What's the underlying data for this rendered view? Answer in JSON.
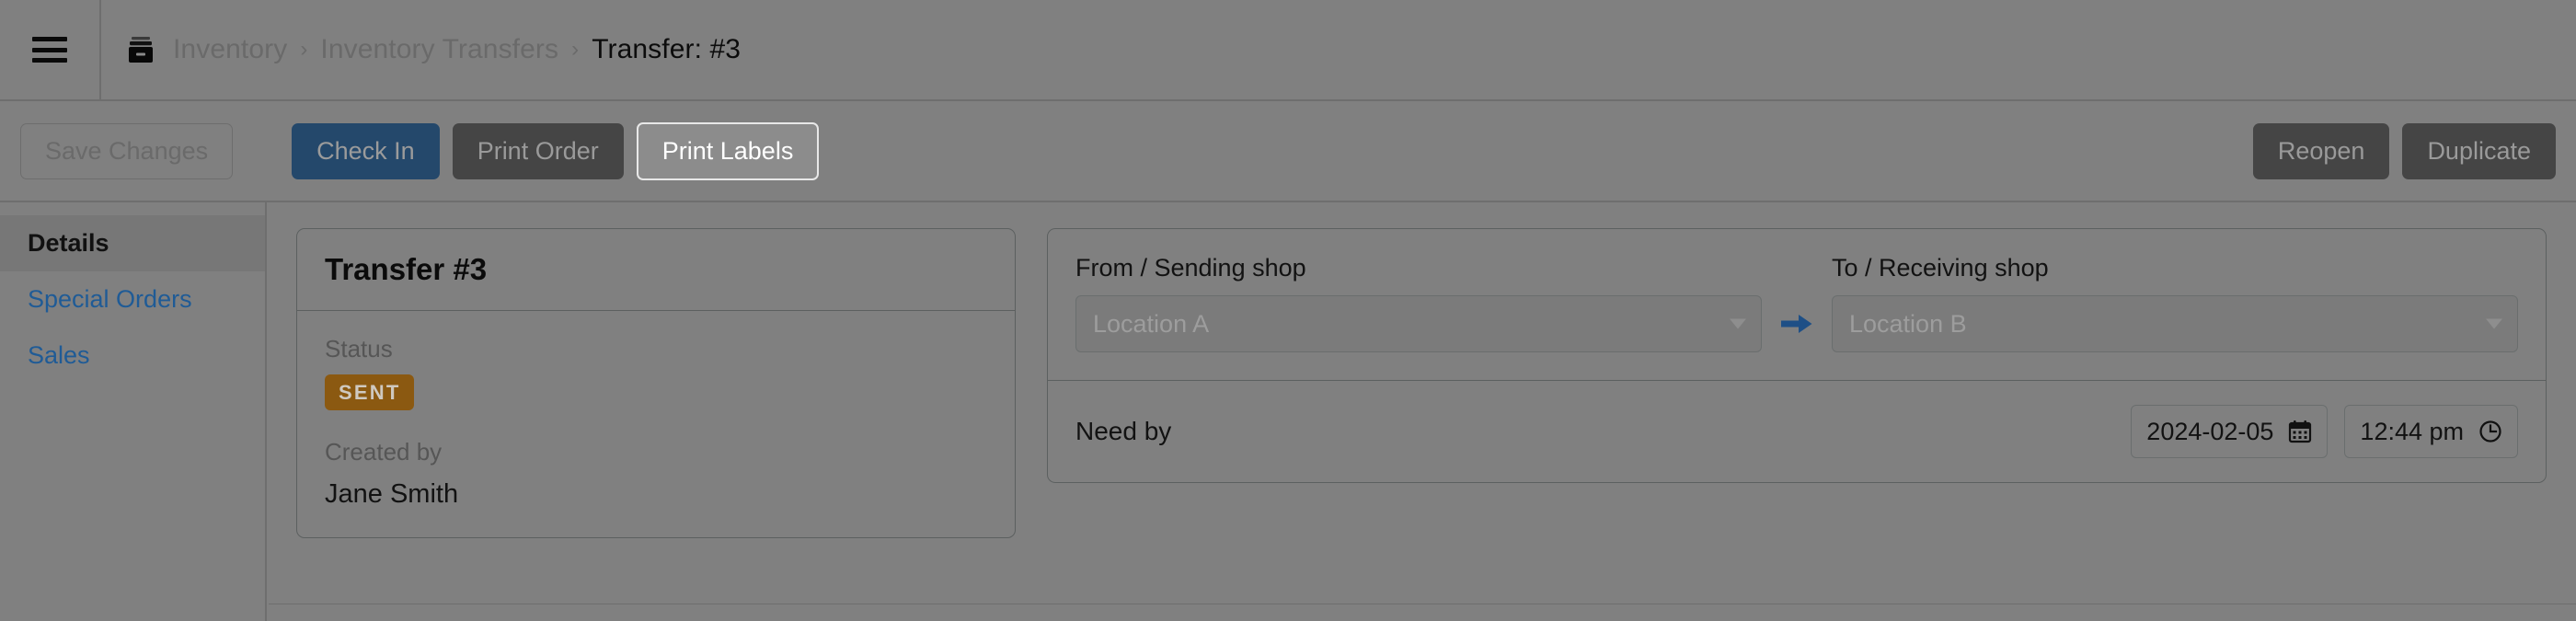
{
  "window": {
    "title": "Transfer: #3"
  },
  "topbar": {
    "menu_icon": "hamburger-icon",
    "breadcrumb": {
      "icon": "archive-box-icon",
      "items": [
        {
          "label": "Inventory",
          "current": false
        },
        {
          "label": "Inventory Transfers",
          "current": false
        },
        {
          "label": "Transfer: #3",
          "current": true
        }
      ],
      "separator": "›"
    }
  },
  "toolbar": {
    "left": [
      {
        "label": "Save Changes",
        "style": "ghost-disabled"
      },
      {
        "label": "Check In",
        "style": "primary"
      },
      {
        "label": "Print Order",
        "style": "dark"
      },
      {
        "label": "Print Labels",
        "style": "focused"
      }
    ],
    "right": [
      {
        "label": "Reopen",
        "style": "dark"
      },
      {
        "label": "Duplicate",
        "style": "dark"
      }
    ]
  },
  "sidebar": {
    "items": [
      {
        "label": "Details",
        "active": true
      },
      {
        "label": "Special Orders",
        "active": false
      },
      {
        "label": "Sales",
        "active": false
      }
    ]
  },
  "details_card": {
    "title": "Transfer #3",
    "status_label": "Status",
    "status_value": "SENT",
    "created_by_label": "Created by",
    "created_by_value": "Jane Smith"
  },
  "shops_card": {
    "from_label": "From / Sending shop",
    "from_value": "Location A",
    "to_label": "To / Receiving shop",
    "to_value": "Location B",
    "arrow_icon": "arrow-right-icon",
    "need_by_label": "Need by",
    "need_by_date": "2024-02-05",
    "need_by_time": "12:44 pm",
    "date_icon": "calendar-icon",
    "time_icon": "clock-icon"
  },
  "colors": {
    "page_background": "#808080",
    "primary_button": "#24486b",
    "dark_button": "#454545",
    "focused_button": "#8c8c8c",
    "status_badge": "#8b5911",
    "link": "#1f5b96",
    "divider": "#6e6e6e",
    "card_border": "#5c6060",
    "arrow": "#1e4f86"
  }
}
